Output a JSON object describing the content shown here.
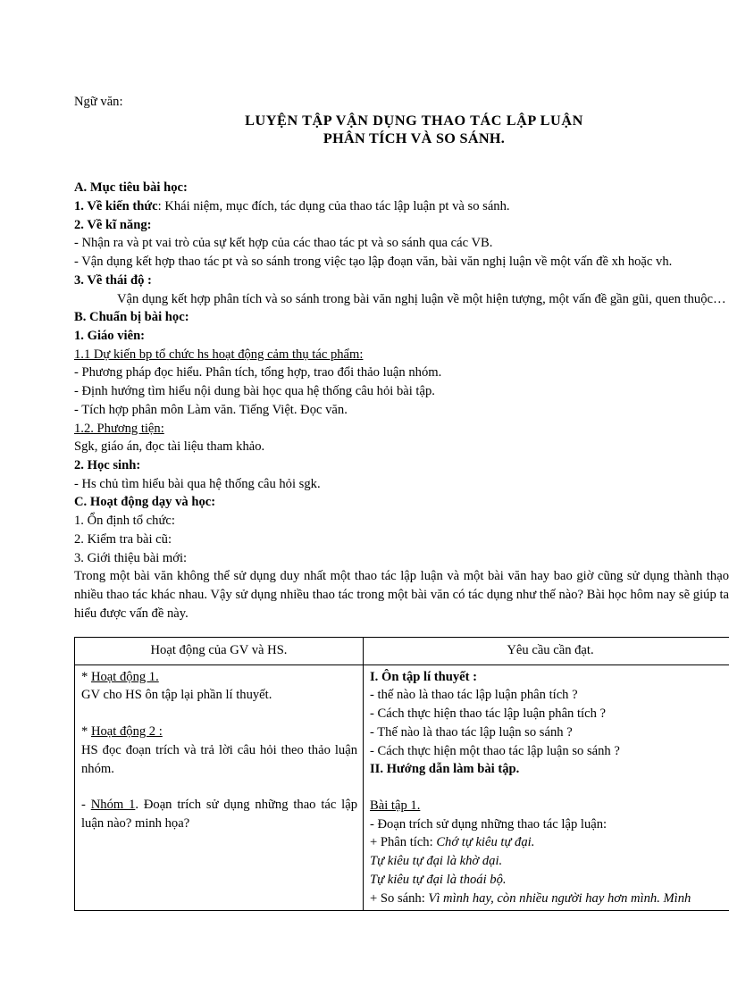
{
  "document": {
    "subject_label": "Ngữ văn:",
    "title_line_1": "LUYỆN TẬP VẬN DỤNG THAO TÁC LẬP LUẬN",
    "title_line_2": "PHÂN TÍCH VÀ SO SÁNH.",
    "section_a": {
      "heading": "A. Mục tiêu bài học:",
      "item_1_label": "1.  Về kiến thức",
      "item_1_text": ": Khái niệm,  mục  đích,  tác dụng  của thao tác lập luận  pt và so sánh.",
      "item_2_label": "2.  Về kĩ năng:",
      "item_2_bullets": [
        "- Nhận ra  và pt vai  trò của sự kết hợp của các thao tác pt và so sánh  qua các VB.",
        "- Vận dụng kết hợp thao tác pt và so sánh trong việc tạo lập đoạn văn, bài văn nghị luận  về một vấn đề xh hoặc vh."
      ],
      "item_3_label": "3.  Về thái độ :",
      "item_3_text": "Vận dụng kết hợp phân tích và so sánh trong bài văn nghị luận về một hiện tượng, một vấn đề gần gũi, quen thuộc…"
    },
    "section_b": {
      "heading": "B. Chuẩn bị bài học:",
      "sub_1": "1. Giáo viên:",
      "sub_1_1": "1.1 Dự kiến bp tổ chức hs hoạt động cảm thụ tác phẩm:",
      "sub_1_1_bullets": [
        "- Phương pháp đọc hiểu. Phân tích, tổng hợp, trao đổi thảo luận nhóm.",
        "- Định hướng tìm hiểu nội dung bài học qua hệ thống câu hỏi bài tập.",
        "- Tích hợp phân môn Làm văn. Tiếng Việt. Đọc văn."
      ],
      "sub_1_2": "1.2. Phương tiện:",
      "sub_1_2_text": "Sgk, giáo án, đọc tài liệu tham khảo.",
      "sub_2": "2. Học sinh:",
      "sub_2_bullets": [
        "- Hs chủ tìm hiểu bài qua hệ thống câu hỏi sgk."
      ]
    },
    "section_c": {
      "heading": "C. Hoạt động dạy và học:",
      "items": [
        "1. Ổn định tổ chức:",
        "2. Kiểm tra bài cũ:",
        "3. Giới thiệu bài mới:"
      ],
      "intro_paragraph": "Trong một bài văn không thể sử dụng duy nhất một thao tác lập luận và một bài văn hay bao giờ cũng sử dụng thành thạo nhiều thao tác khác nhau. Vậy sử dụng nhiều thao tác trong một bài văn có tác dụng như thế nào? Bài học hôm nay sẽ giúp ta hiểu được vấn đề này."
    },
    "table": {
      "header_left": "Hoạt động của GV và HS.",
      "header_right": "Yêu cầu cần đạt.",
      "left_cell": {
        "activity_1_marker": "*",
        "activity_1_title": "Hoạt động 1.",
        "activity_1_text": "GV cho HS ôn tập lại phần lí thuyết.",
        "activity_2_marker": "*",
        "activity_2_title": "Hoạt động 2 :",
        "activity_2_text": "HS đọc đoạn trích và trả lời câu hỏi theo thảo luận nhóm.",
        "group_dash": "-",
        "group_title": "Nhóm 1",
        "group_text": ". Đoạn trích sử dụng những thao tác lập luận nào? minh họa?"
      },
      "right_cell": {
        "part_1_heading": "I. Ôn tập lí thuyết :",
        "part_1_questions": [
          "- thế nào là thao tác lập luận phân tích ?",
          "- Cách thực hiện thao tác lập luận phân tích ?",
          "- Thế nào là thao tác lập luận so sánh ?",
          "- Cách thực hiện một thao tác lập luận so sánh ?"
        ],
        "part_2_heading": "II. Hướng dẫn làm bài tập.",
        "exercise_title": "Bài tập 1.",
        "exercise_intro": "- Đoạn trích sử dụng những thao tác lập luận:",
        "analysis_label": "+ Phân tích:",
        "analysis_quotes": [
          "Chớ tự kiêu tự đại.",
          "Tự kiêu tự đại là khờ dại.",
          "Tự kiêu tự đại là thoái bộ."
        ],
        "comparison_label": "+ So sánh:",
        "comparison_quote": "Vì mình hay, còn nhiều người hay hơn mình. Mình"
      }
    }
  }
}
